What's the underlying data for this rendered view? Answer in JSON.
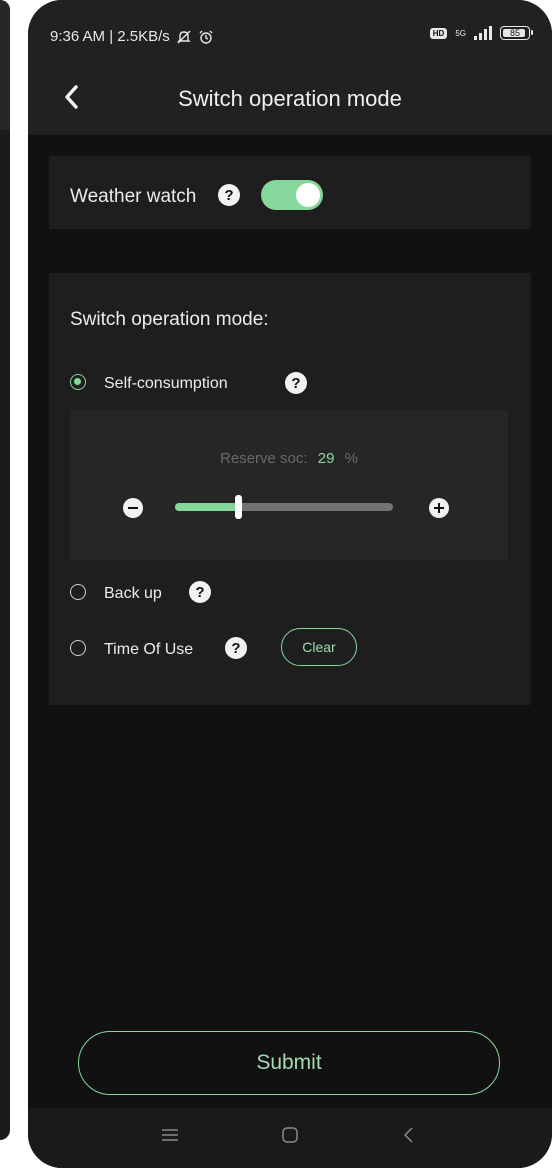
{
  "status_bar": {
    "time_speed": "9:36 AM | 2.5KB/s",
    "network": "5G",
    "hd_badge": "HD",
    "battery_level": "85"
  },
  "header": {
    "title": "Switch operation mode",
    "back_icon": "chevron-left-icon"
  },
  "weather_watch": {
    "label": "Weather watch",
    "enabled": true,
    "help_icon": "question-icon"
  },
  "operation_mode": {
    "heading": "Switch operation mode:",
    "selected": "Self-consumption",
    "options": [
      {
        "label": "Self-consumption",
        "selected": true
      },
      {
        "label": "Back up",
        "selected": false
      },
      {
        "label": "Time Of Use",
        "selected": false
      }
    ],
    "reserve": {
      "label": "Reserve soc:",
      "value": "29",
      "unit": "%",
      "slider_fraction": 0.29
    },
    "clear_label": "Clear"
  },
  "submit_label": "Submit",
  "colors": {
    "accent": "#86d79b",
    "background": "#111111",
    "card": "#1e1e1e"
  },
  "nav": [
    "menu-icon",
    "home-icon",
    "back-icon"
  ]
}
